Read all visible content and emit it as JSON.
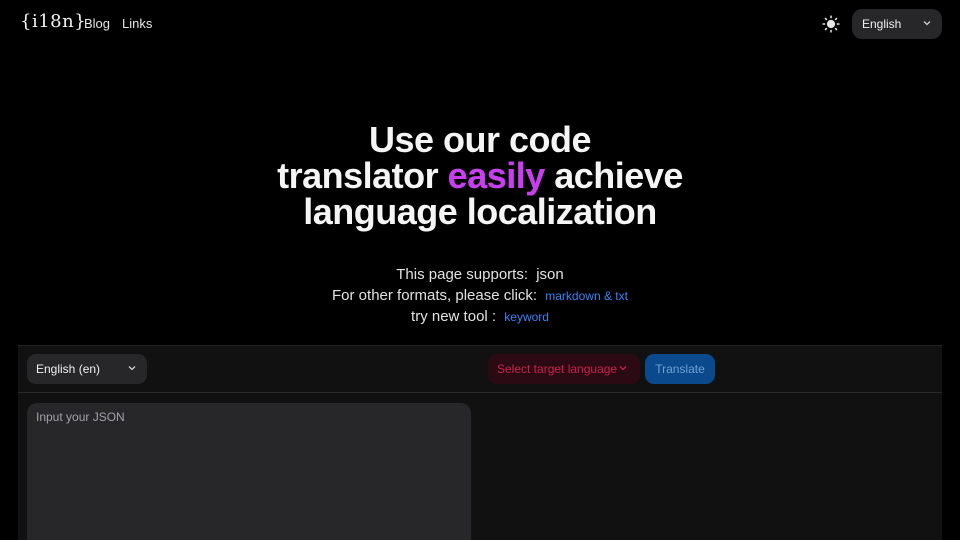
{
  "header": {
    "logo": "{i18n}",
    "nav": {
      "blog": "Blog",
      "links": "Links"
    },
    "theme_icon": "sun-icon",
    "language": "English"
  },
  "hero": {
    "line1": "Use our code",
    "line2_pre": "translator ",
    "line2_accent": "easily",
    "line2_post": " achieve",
    "line3": "language localization",
    "accent_color": "#c83ff0"
  },
  "info": {
    "supports_label": "This page supports:",
    "supports_format": "json",
    "other_label": "For other formats, please click:",
    "other_link": "markdown & txt",
    "tool_label": "try new tool :",
    "tool_link": "keyword"
  },
  "translator": {
    "source_language": "English (en)",
    "target_placeholder": "Select target language",
    "translate_label": "Translate",
    "input_placeholder": "Input your JSON"
  }
}
